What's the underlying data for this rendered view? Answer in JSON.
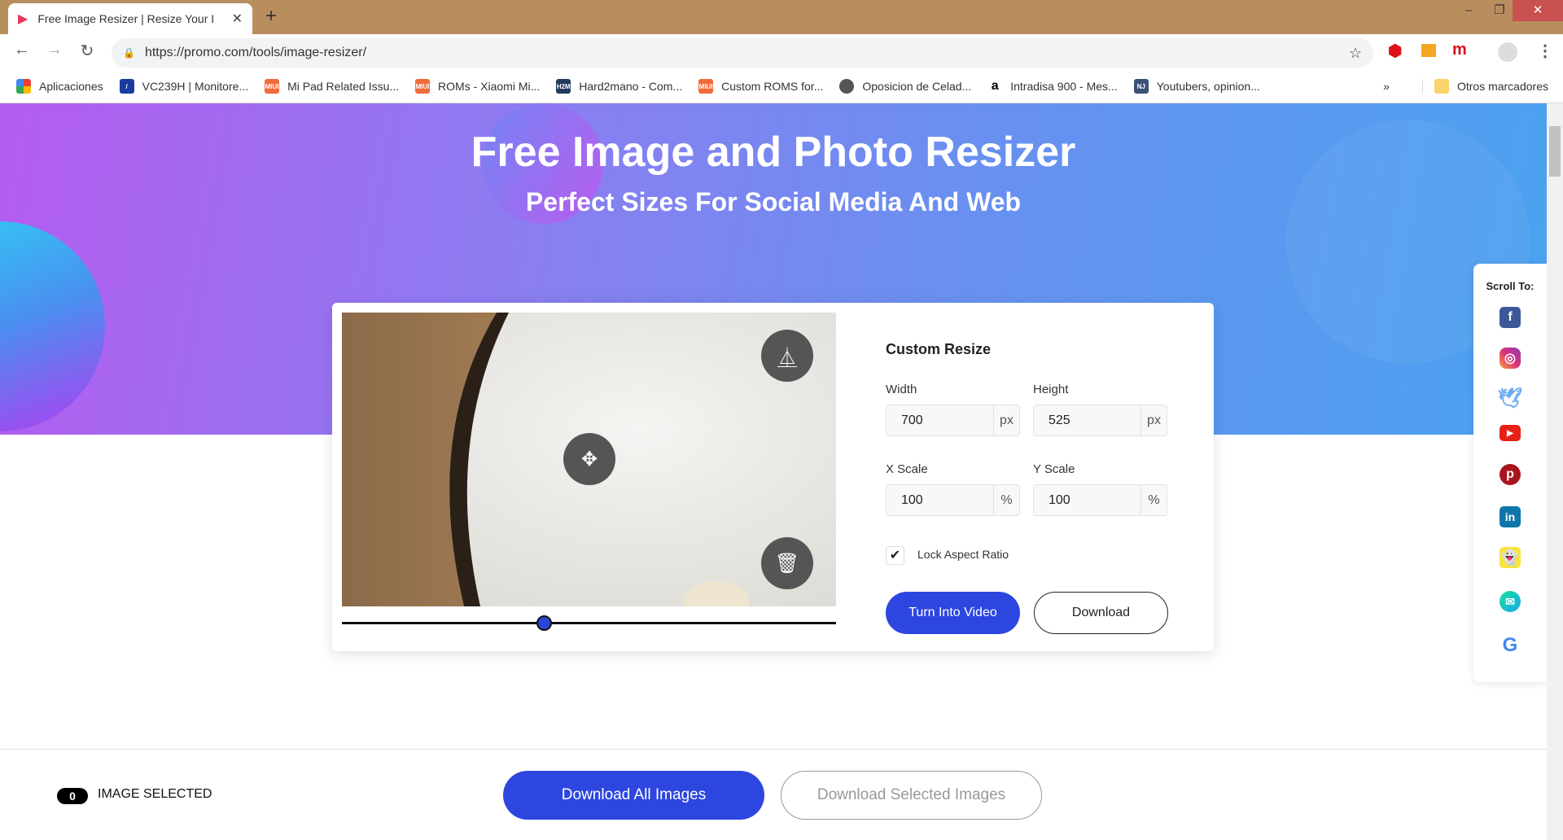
{
  "browser": {
    "tab_title": "Free Image Resizer | Resize Your I",
    "url": "https://promo.com/tools/image-resizer/",
    "bookmarks": [
      {
        "label": "Aplicaciones",
        "color": "#e94235"
      },
      {
        "label": "VC239H | Monitore...",
        "color": "#1a3c9e"
      },
      {
        "label": "Mi Pad Related Issu...",
        "color": "#f26b3a"
      },
      {
        "label": "ROMs - Xiaomi Mi...",
        "color": "#f26b3a"
      },
      {
        "label": "Hard2mano - Com...",
        "color": "#23395d"
      },
      {
        "label": "Custom ROMS for...",
        "color": "#f26b3a"
      },
      {
        "label": "Oposicion de Celad...",
        "color": "#555555"
      },
      {
        "label": "Intradisa 900 - Mes...",
        "color": "#ffffff"
      },
      {
        "label": "Youtubers, opinion...",
        "color": "#3b5278"
      }
    ],
    "more": "»",
    "other_bookmarks": "Otros marcadores"
  },
  "hero": {
    "title": "Free Image and Photo Resizer",
    "subtitle": "Perfect Sizes For Social Media And Web"
  },
  "editor": {
    "heading": "Custom Resize",
    "width": {
      "label": "Width",
      "value": "700",
      "unit": "px"
    },
    "height": {
      "label": "Height",
      "value": "525",
      "unit": "px"
    },
    "x_scale": {
      "label": "X Scale",
      "value": "100",
      "unit": "%"
    },
    "y_scale": {
      "label": "Y Scale",
      "value": "100",
      "unit": "%"
    },
    "lock_aspect_ratio": {
      "label": "Lock Aspect Ratio",
      "checked": true
    },
    "turn_into_video": "Turn Into Video",
    "download": "Download",
    "zoom_slider_percent": 41,
    "accent": "#2d46e0"
  },
  "sidebar": {
    "title": "Scroll To:",
    "items": [
      "facebook",
      "instagram",
      "twitter",
      "youtube",
      "pinterest",
      "linkedin",
      "snapchat",
      "email",
      "google"
    ]
  },
  "bottom": {
    "count": "0",
    "selected_label": "IMAGE SELECTED",
    "download_all": "Download All Images",
    "download_selected": "Download Selected Images"
  }
}
